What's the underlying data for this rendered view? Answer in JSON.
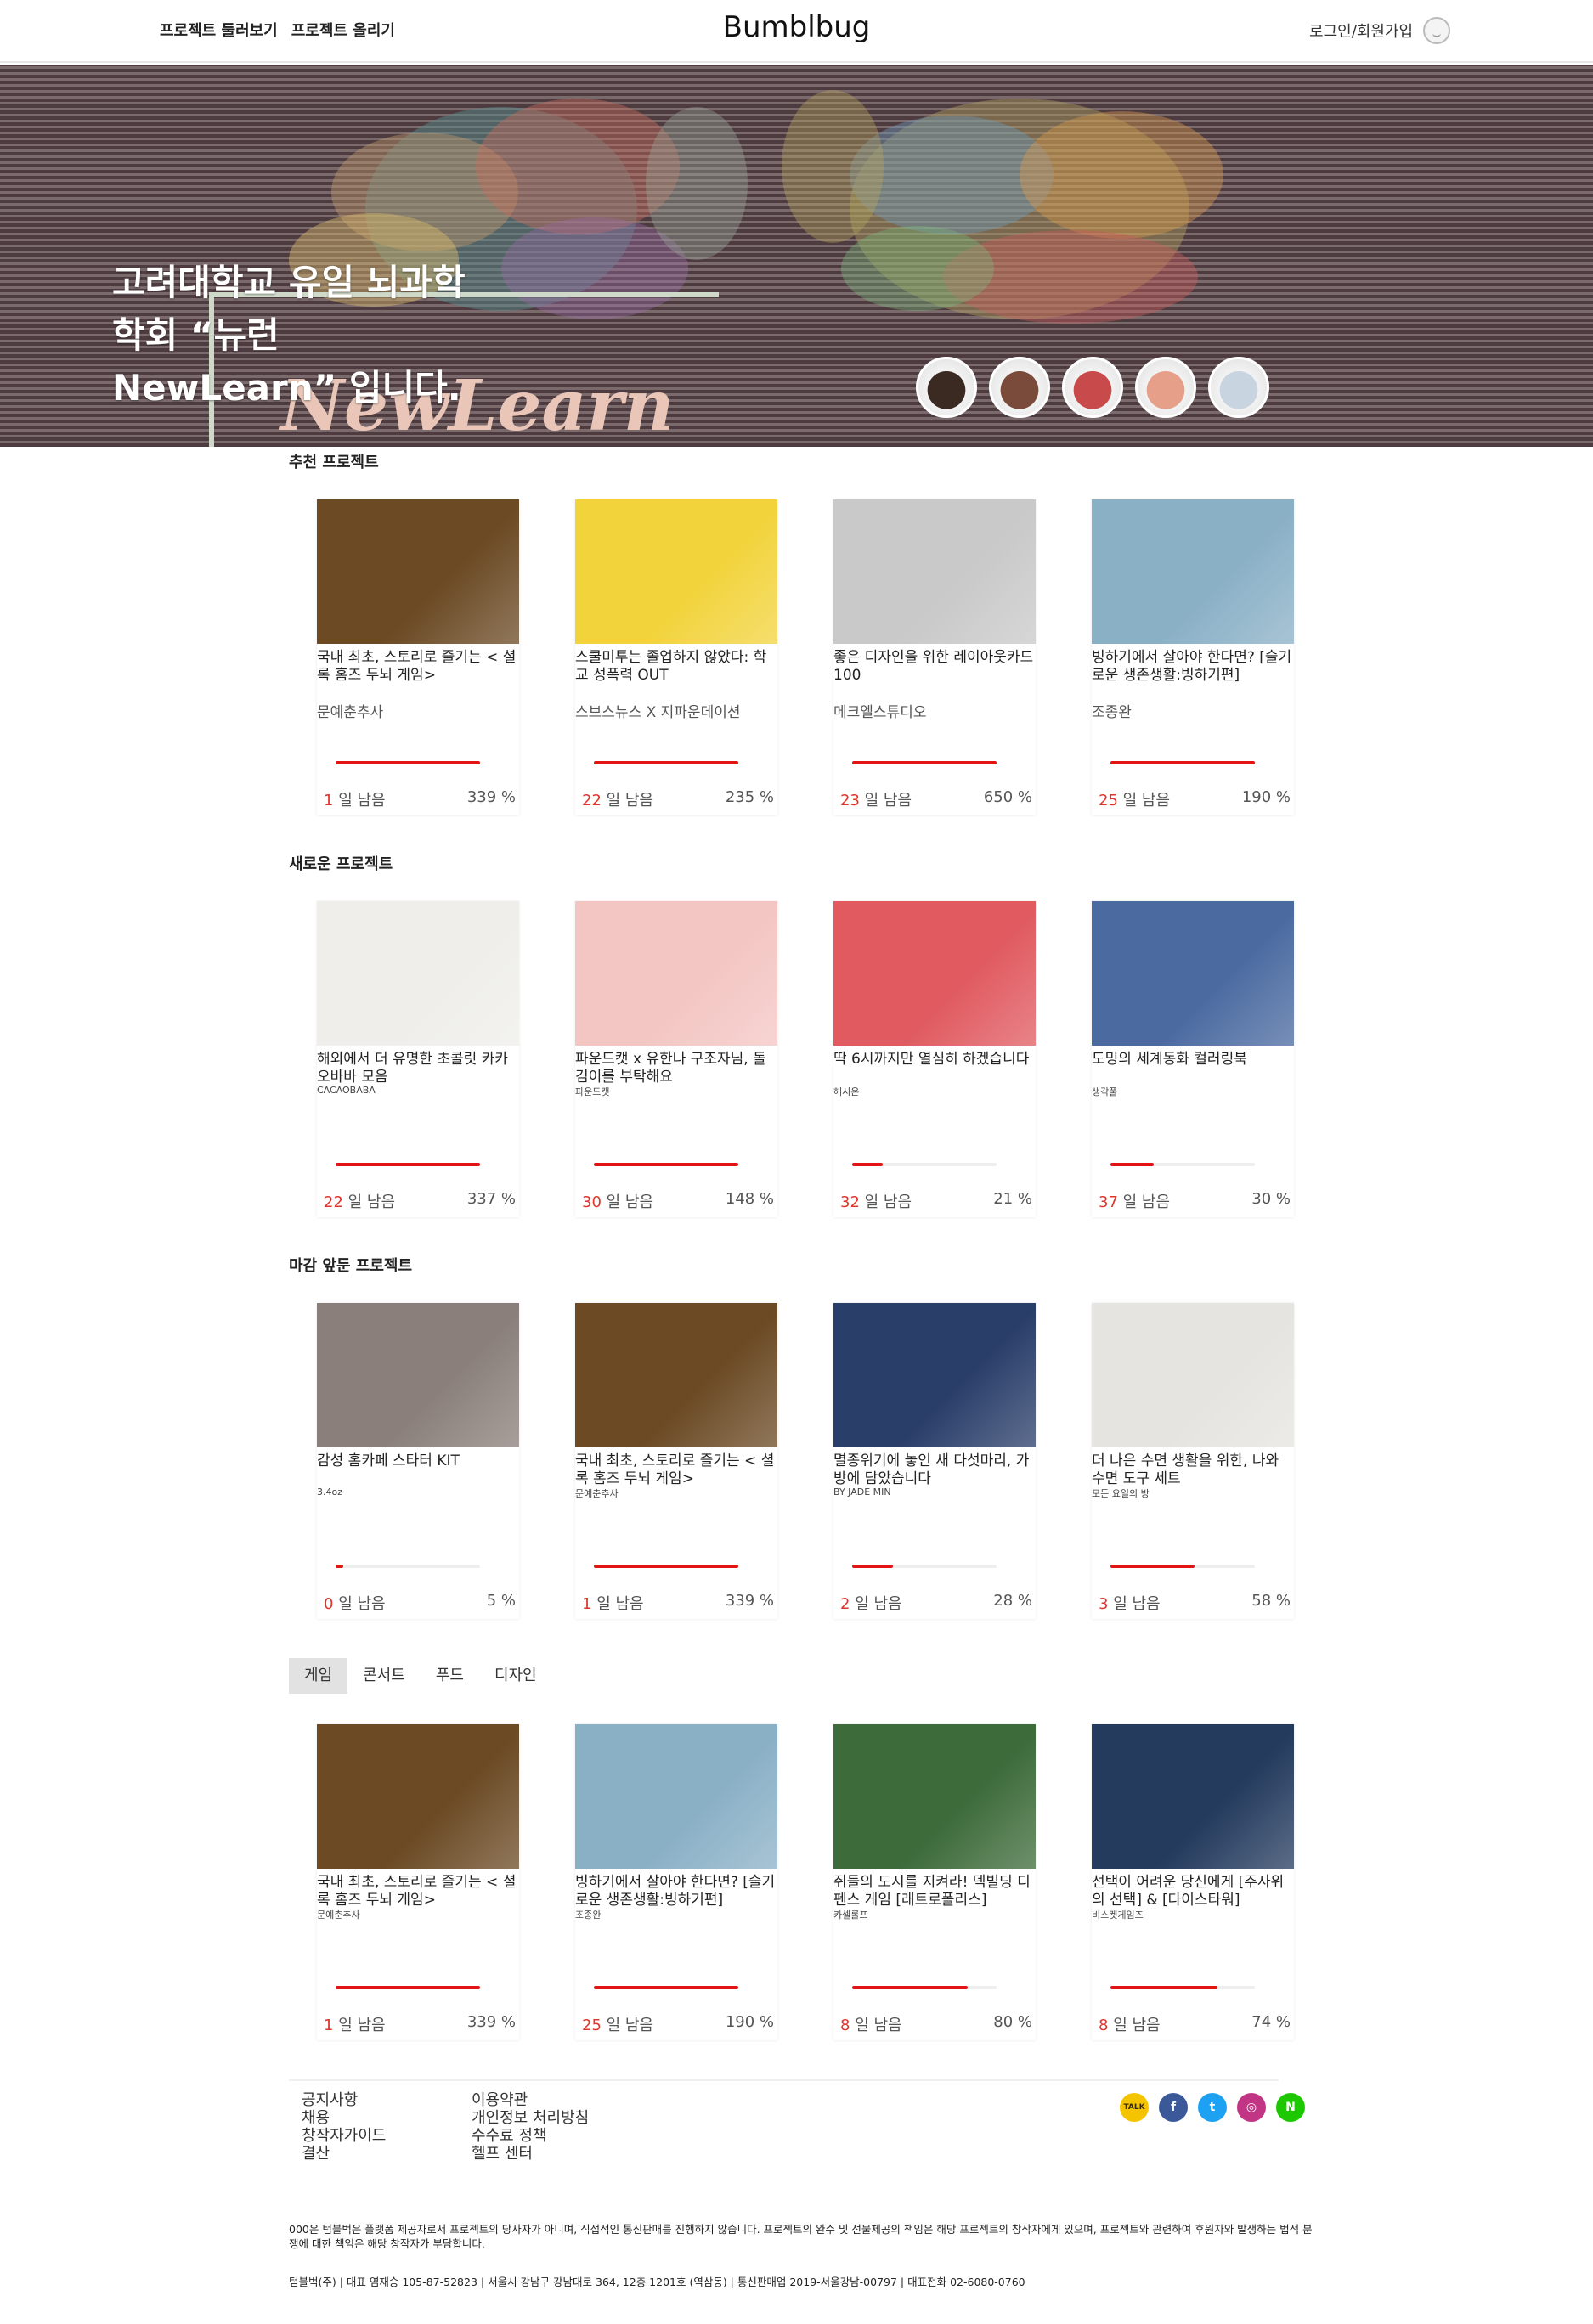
{
  "header": {
    "nav_browse": "프로젝트 둘러보기",
    "nav_upload": "프로젝트 올리기",
    "logo": "Bumblbug",
    "login": "로그인/회원가입"
  },
  "hero": {
    "title_line1": "고려대학교 유일 뇌과학",
    "title_line2": "학회 “뉴런",
    "title_line3": "NewLearn” 입니다.",
    "banner_word": "NewLearn",
    "thumb_colors": [
      "#3a2a22",
      "#7a4a3a",
      "#c84a4a",
      "#e6a08a",
      "#c8d4e0"
    ]
  },
  "sections": {
    "recommended": "추천 프로젝트",
    "new": "새로운 프로젝트",
    "closing": "마감 앞둔 프로젝트"
  },
  "labels": {
    "days_left": "일 남음"
  },
  "recommended": [
    {
      "title": "국내 최초, 스토리로 즐기는 < 셜록 홈즈 두뇌 게임>",
      "creator": "문예춘추사",
      "days": "1",
      "percent": "339 %",
      "progress": 1.0,
      "color": "#6b4a24"
    },
    {
      "title": "스쿨미투는 졸업하지 않았다: 학교 성폭력 OUT",
      "creator": "스브스뉴스 X 지파운데이션",
      "days": "22",
      "percent": "235 %",
      "progress": 1.0,
      "color": "#f2d33c"
    },
    {
      "title": "좋은 디자인을 위한 레이아웃카드100",
      "creator": "메크엘스튜디오",
      "days": "23",
      "percent": "650 %",
      "progress": 1.0,
      "color": "#c9c9c9"
    },
    {
      "title": "빙하기에서 살아야 한다면? [슬기로운 생존생활:빙하기편]",
      "creator": "조종완",
      "days": "25",
      "percent": "190 %",
      "progress": 1.0,
      "color": "#8ab0c6"
    }
  ],
  "new_projects": [
    {
      "title": "해외에서 더 유명한 초콜릿 카카오바바 모음",
      "creator": "CACAOBABA",
      "days": "22",
      "percent": "337 %",
      "progress": 1.0,
      "color": "#efeeea"
    },
    {
      "title": "파운드캣 x 유한나 구조자님, 돌김이를 부탁해요",
      "creator": "파운드캣",
      "days": "30",
      "percent": "148 %",
      "progress": 1.0,
      "color": "#f3c6c3"
    },
    {
      "title": "딱 6시까지만 열심히 하겠습니다",
      "creator": "해시온",
      "days": "32",
      "percent": "21 %",
      "progress": 0.21,
      "color": "#e05a60"
    },
    {
      "title": "도밍의 세계동화 컬러링북",
      "creator": "생각풀",
      "days": "37",
      "percent": "30 %",
      "progress": 0.3,
      "color": "#4a6aa0"
    }
  ],
  "closing": [
    {
      "title": "감성 홈카페 스타터 KIT",
      "creator": "3.4oz",
      "days": "0",
      "percent": "5 %",
      "progress": 0.05,
      "color": "#8a7f7a"
    },
    {
      "title": "국내 최초, 스토리로 즐기는 < 셜록 홈즈 두뇌 게임>",
      "creator": "문예춘추사",
      "days": "1",
      "percent": "339 %",
      "progress": 1.0,
      "color": "#6b4a24"
    },
    {
      "title": "멸종위기에 놓인 새 다섯마리, 가방에 담았습니다",
      "creator": "BY JADE MIN",
      "days": "2",
      "percent": "28 %",
      "progress": 0.28,
      "color": "#2a3e6a"
    },
    {
      "title": "더 나은 수면 생활을 위한, 나와 수면 도구 세트",
      "creator": "모든 요일의 방",
      "days": "3",
      "percent": "58 %",
      "progress": 0.58,
      "color": "#e6e4e0"
    }
  ],
  "category_tabs": [
    "게임",
    "콘서트",
    "푸드",
    "디자인"
  ],
  "category_projects": [
    {
      "title": "국내 최초, 스토리로 즐기는 < 셜록 홈즈 두뇌 게임>",
      "creator": "문예춘추사",
      "days": "1",
      "percent": "339 %",
      "progress": 1.0,
      "color": "#6b4a24"
    },
    {
      "title": "빙하기에서 살아야 한다면? [슬기로운 생존생활:빙하기편]",
      "creator": "조종완",
      "days": "25",
      "percent": "190 %",
      "progress": 1.0,
      "color": "#8ab0c6"
    },
    {
      "title": "쥐들의 도시를 지켜라! 덱빌딩 디펜스 게임 [래트로폴리스]",
      "creator": "카셀롤프",
      "days": "8",
      "percent": "80 %",
      "progress": 0.8,
      "color": "#3d6b3a"
    },
    {
      "title": "선택이 어려운 당신에게 [주사위의 선택] & [다이스타워]",
      "creator": "비스켓게임즈",
      "days": "8",
      "percent": "74 %",
      "progress": 0.74,
      "color": "#243b5e"
    }
  ],
  "footer": {
    "col1": [
      "공지사항",
      "채용",
      "창작자가이드",
      "결산"
    ],
    "col2": [
      "이용약관",
      "개인정보 처리방침",
      "수수료 정책",
      "헬프 센터"
    ],
    "social": [
      {
        "name": "kakaotalk-icon",
        "label": "TALK",
        "color": "#f5c400",
        "text": "#3a2a00"
      },
      {
        "name": "facebook-icon",
        "label": "f",
        "color": "#3b5998",
        "text": "#ffffff"
      },
      {
        "name": "twitter-icon",
        "label": "t",
        "color": "#1da1f2",
        "text": "#ffffff"
      },
      {
        "name": "instagram-icon",
        "label": "◎",
        "color": "#c13584",
        "text": "#ffffff"
      },
      {
        "name": "naver-icon",
        "label": "N",
        "color": "#1ec800",
        "text": "#ffffff"
      }
    ],
    "disclaimer": "000은 텀블벅은 플랫폼 제공자로서 프로젝트의 당사자가 아니며, 직접적인 통신판매를 진행하지 않습니다. 프로젝트의 완수 및 선물제공의 책임은 해당 프로젝트의 창작자에게 있으며, 프로젝트와 관련하여 후원자와 발생하는 법적 분쟁에 대한 책임은 해당 창작자가 부담합니다.",
    "company": "텀블벅(주) | 대표 염재승 105-87-52823 | 서울시 강남구 강남대로 364, 12층 1201호 (역삼동) | 통신판매업 2019-서울강남-00797 | 대표전화 02-6080-0760"
  }
}
